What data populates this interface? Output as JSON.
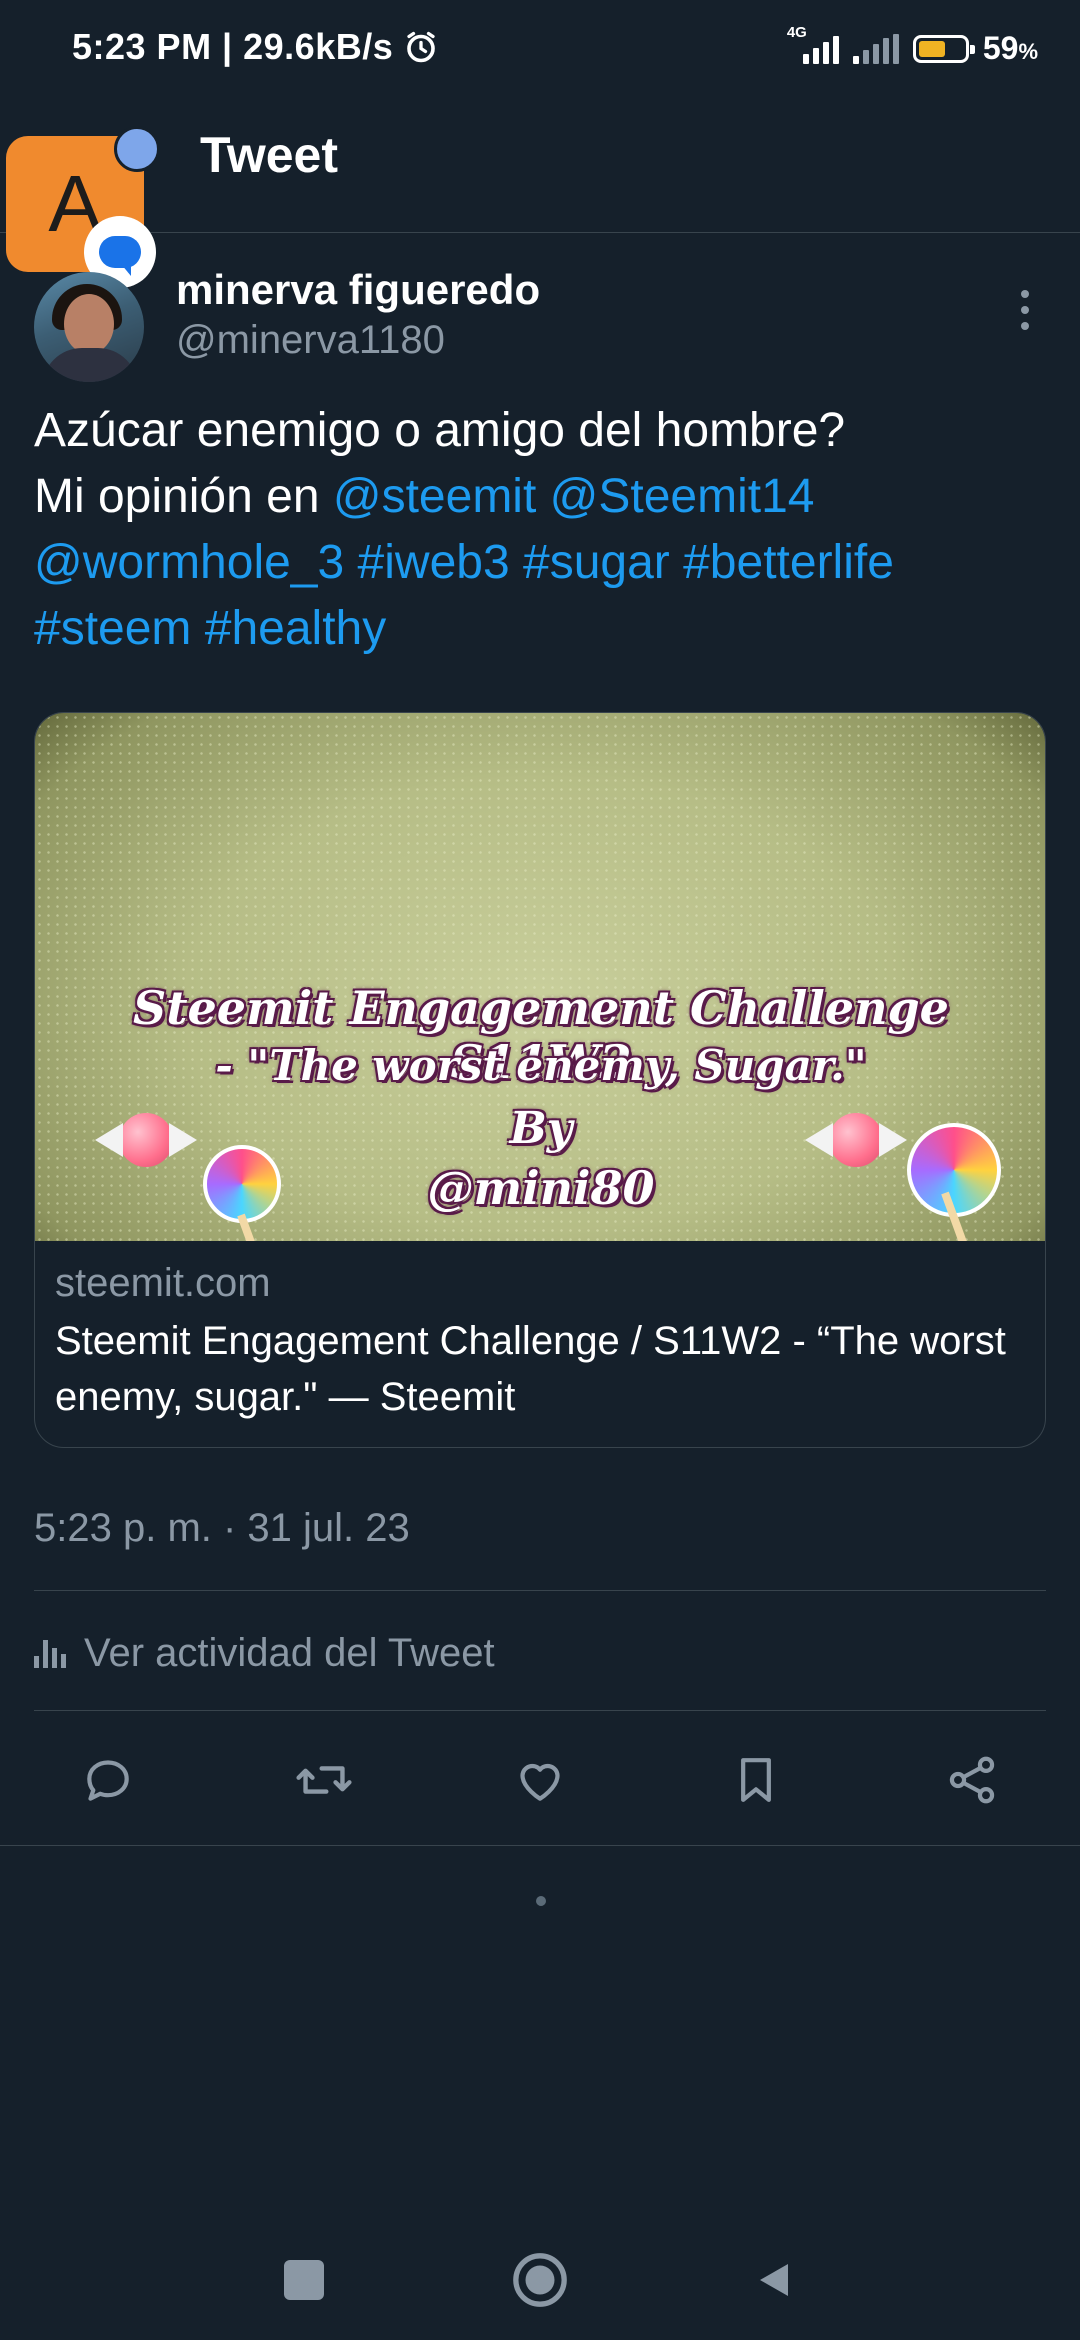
{
  "status_bar": {
    "time_speed": "5:23 PM | 29.6kB/s",
    "network_tag": "4G",
    "battery_pct": "59",
    "battery_unit": "%",
    "battery_level": 0.59
  },
  "header": {
    "title": "Tweet",
    "badge_letter": "A"
  },
  "tweet": {
    "author_name": "minerva figueredo",
    "author_handle": "@minerva1180",
    "text_line1": "Azúcar enemigo o amigo del hombre?",
    "text_line2_prefix": "Mi opinión en ",
    "mention1": "@steemit",
    "mention2": "@Steemit14",
    "mention3": "@wormhole_3",
    "hashtag1": "#iweb3",
    "hashtag2": "#sugar",
    "hashtag3": "#betterlife",
    "hashtag4": "#steem",
    "hashtag5": "#healthy",
    "timestamp": "5:23 p. m. · 31 jul. 23",
    "activity_label": "Ver actividad del Tweet"
  },
  "card": {
    "image_line1": "Steemit Engagement Challenge  S11W2",
    "image_line2": "- \"The worst enemy, Sugar.\"",
    "image_line3": "By",
    "image_line4": "@mini80",
    "domain": "steemit.com",
    "title": "Steemit Engagement Challenge / S11W2 - “The worst enemy, sugar.\" — Steemit"
  },
  "actions": [
    "reply-icon",
    "retweet-icon",
    "like-icon",
    "bookmark-icon",
    "share-icon"
  ],
  "colors": {
    "background": "#15202b",
    "link": "#1d9bf0",
    "secondary_text": "#8b98a5",
    "divider": "#38444d"
  }
}
